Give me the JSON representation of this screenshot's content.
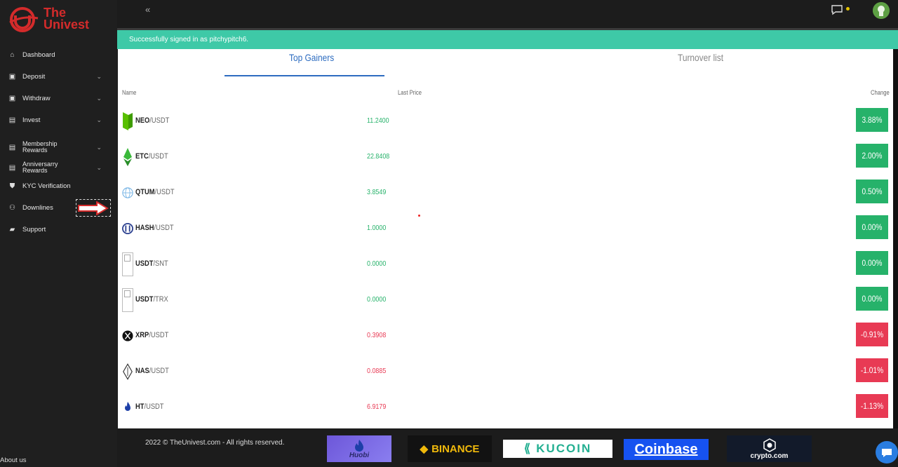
{
  "brand": {
    "name_line1": "The",
    "name_line2": "Univest",
    "color": "#d42b2b"
  },
  "sidebar": {
    "items": [
      {
        "label": "Dashboard",
        "icon": "dashboard-icon",
        "chevron": false
      },
      {
        "label": "Deposit",
        "icon": "briefcase-icon",
        "chevron": true
      },
      {
        "label": "Withdraw",
        "icon": "briefcase-icon",
        "chevron": true
      },
      {
        "label": "Invest",
        "icon": "chart-icon",
        "chevron": true
      },
      {
        "label": "Membership\nRewards",
        "icon": "chart-icon",
        "chevron": true
      },
      {
        "label": "Anniversarry\nRewards",
        "icon": "chart-icon",
        "chevron": true
      },
      {
        "label": "KYC Verification",
        "icon": "shield-icon",
        "chevron": false
      },
      {
        "label": "Downlines",
        "icon": "users-icon",
        "chevron": false
      },
      {
        "label": "Support",
        "icon": "chat-icon",
        "chevron": false
      }
    ],
    "about": "About us"
  },
  "alert": {
    "message": "Successfully signed in as pitchypitch6."
  },
  "tabs": {
    "active": "Top Gainers",
    "inactive": "Turnover list"
  },
  "table": {
    "headers": {
      "name": "Name",
      "price": "Last Price",
      "change": "Change"
    },
    "rows": [
      {
        "base": "NEO",
        "quote": "/USDT",
        "price": "11.2400",
        "change": "3.88%",
        "dir": "up",
        "icon": "neo-icon"
      },
      {
        "base": "ETC",
        "quote": "/USDT",
        "price": "22.8408",
        "change": "2.00%",
        "dir": "up",
        "icon": "etc-icon"
      },
      {
        "base": "QTUM",
        "quote": "/USDT",
        "price": "3.8549",
        "change": "0.50%",
        "dir": "up",
        "icon": "qtum-icon"
      },
      {
        "base": "HASH",
        "quote": "/USDT",
        "price": "1.0000",
        "change": "0.00%",
        "dir": "up",
        "icon": "hash-icon"
      },
      {
        "base": "USDT",
        "quote": "/SNT",
        "price": "0.0000",
        "change": "0.00%",
        "dir": "up",
        "icon": "broken-image-icon"
      },
      {
        "base": "USDT",
        "quote": "/TRX",
        "price": "0.0000",
        "change": "0.00%",
        "dir": "up",
        "icon": "broken-image-icon"
      },
      {
        "base": "XRP",
        "quote": "/USDT",
        "price": "0.3908",
        "change": "-0.91%",
        "dir": "down",
        "icon": "xrp-icon"
      },
      {
        "base": "NAS",
        "quote": "/USDT",
        "price": "0.0885",
        "change": "-1.01%",
        "dir": "down",
        "icon": "nas-icon"
      },
      {
        "base": "HT",
        "quote": "/USDT",
        "price": "6.9179",
        "change": "-1.13%",
        "dir": "down",
        "icon": "ht-icon"
      }
    ]
  },
  "footer": {
    "copyright": "2022 © TheUnivest.com - All rights reserved.",
    "partners": [
      "Huobi",
      "BINANCE",
      "KUCOIN",
      "Coinbase",
      "crypto.com"
    ]
  },
  "colors": {
    "up": "#26b26a",
    "down": "#e83a54",
    "accent": "#2d6cc0",
    "alert": "#3ec9a7"
  }
}
